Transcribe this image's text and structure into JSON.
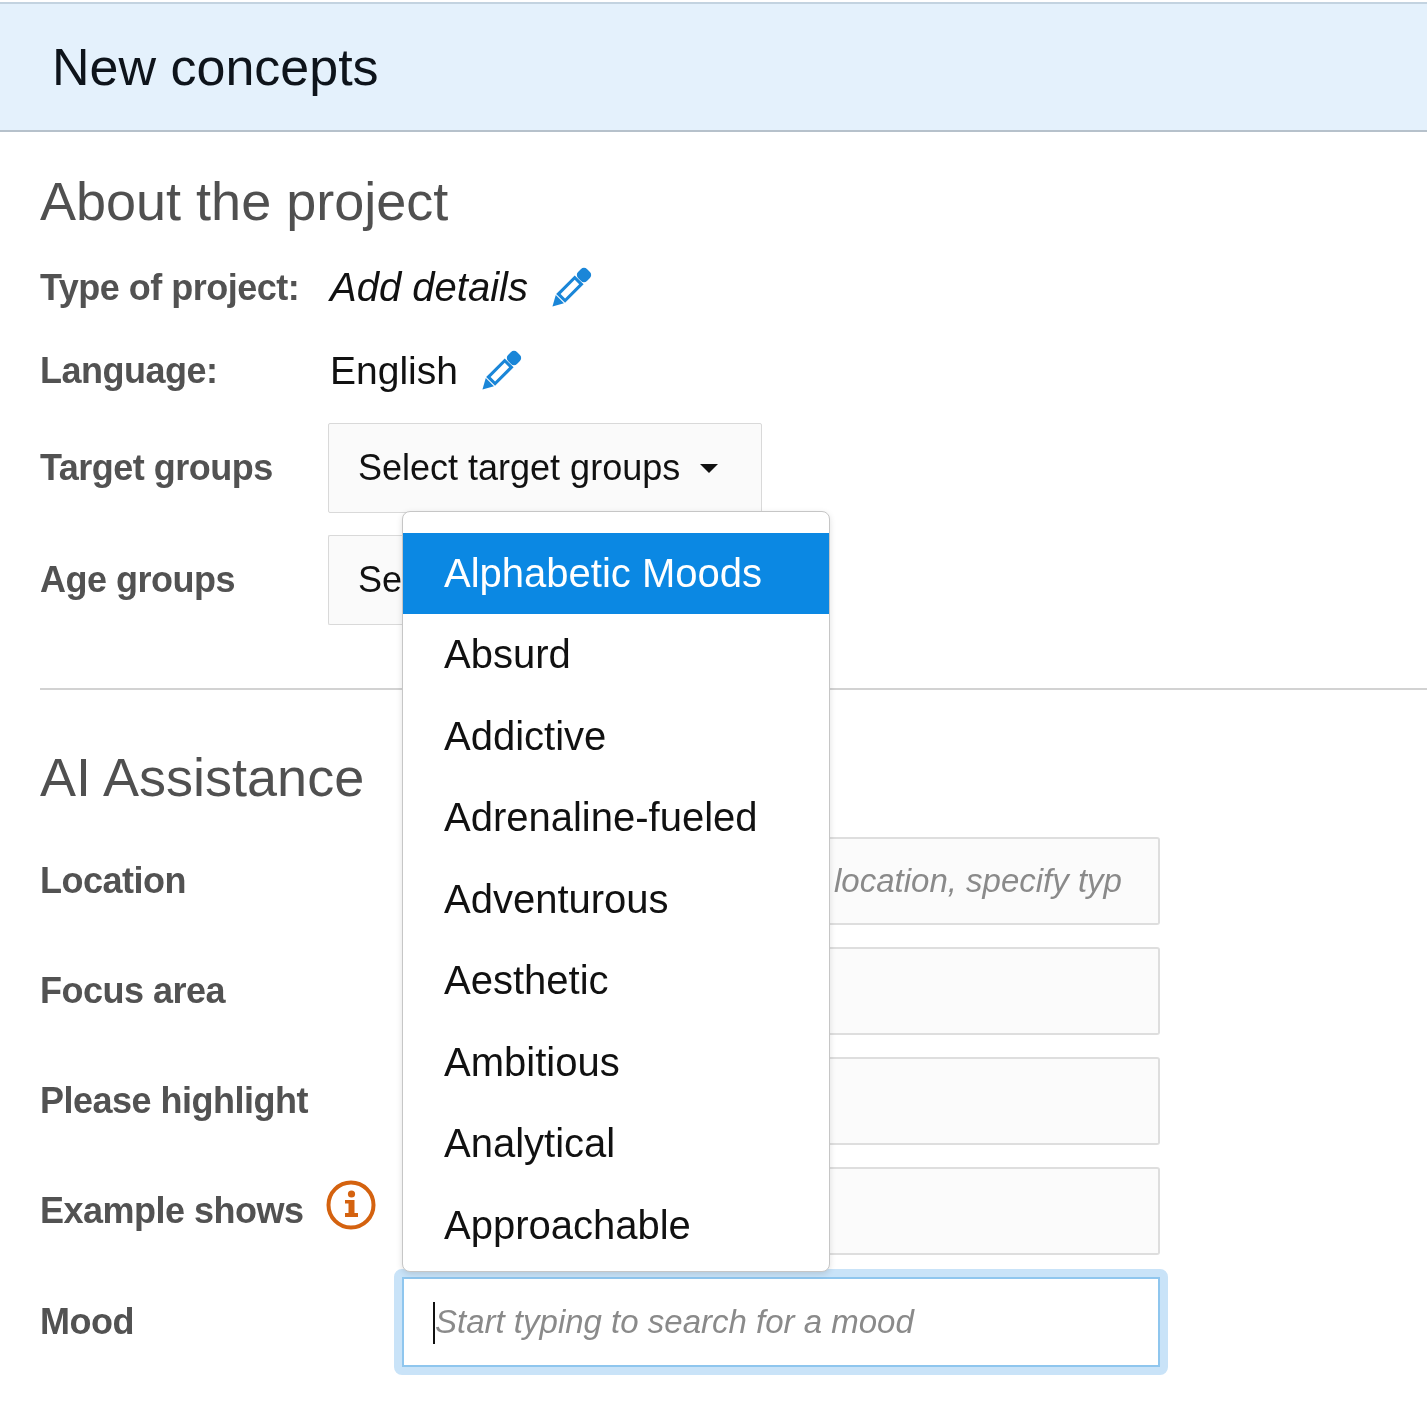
{
  "header": {
    "title": "New concepts"
  },
  "about": {
    "title": "About the project",
    "details": [
      {
        "label": "Type of project:",
        "value": "Add details",
        "empty": true
      },
      {
        "label": "Language:",
        "value": "English",
        "empty": false
      }
    ],
    "selects": [
      {
        "label": "Target groups",
        "value": "Select target groups",
        "caret": true
      },
      {
        "label": "Age groups",
        "value": "Se",
        "caret": false
      }
    ]
  },
  "ai": {
    "title": "AI Assistance",
    "fields": [
      {
        "label": "Location",
        "placeholder": "location, specify typ",
        "info": false
      },
      {
        "label": "Focus area",
        "info": false
      },
      {
        "label": "Please highlight",
        "info": false
      },
      {
        "label": "Example shows",
        "info": true
      }
    ],
    "mood": {
      "label": "Mood",
      "placeholder": "Start typing to search for a mood",
      "focused": true,
      "suggestions": [
        {
          "label": "Alphabetic Moods",
          "selected": true
        },
        {
          "label": "Absurd",
          "selected": false
        },
        {
          "label": "Addictive",
          "selected": false
        },
        {
          "label": "Adrenaline-fueled",
          "selected": false
        },
        {
          "label": "Adventurous",
          "selected": false
        },
        {
          "label": "Aesthetic",
          "selected": false
        },
        {
          "label": "Ambitious",
          "selected": false
        },
        {
          "label": "Analytical",
          "selected": false
        },
        {
          "label": "Approachable",
          "selected": false
        }
      ]
    }
  }
}
